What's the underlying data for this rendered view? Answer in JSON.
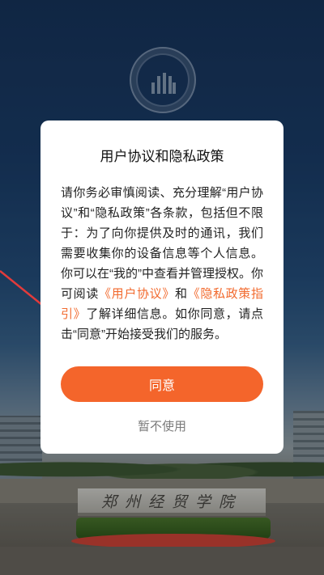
{
  "background": {
    "emblem_text": "郑州经贸学院",
    "gate_sign": "郑州经贸学院"
  },
  "dialog": {
    "title": "用户协议和隐私政策",
    "body": {
      "part1": "请你务必审慎阅读、充分理解“用户协议”和“隐私政策”各条款，包括但不限于：为了向你提供及时的通讯，我们需要收集你的设备信息等个人信息。你可以在“我的”中查看并管理授权。你可阅读",
      "link_user_agreement": "《用户协议》",
      "part2": "和",
      "link_privacy_guide": "《隐私政策指引》",
      "part3": "了解详细信息。如你同意，请点击“同意”开始接受我们的服务。"
    },
    "agree_label": "同意",
    "decline_label": "暂不使用"
  },
  "colors": {
    "accent": "#f4652b",
    "link": "#f26a2e",
    "annotation_arrow": "#e23b3b"
  }
}
